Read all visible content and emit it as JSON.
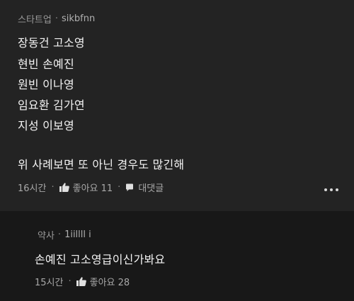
{
  "comment": {
    "author": "스타트업",
    "author_id": "sikbfnn",
    "lines": [
      "장동건 고소영",
      "현빈 손예진",
      "원빈 이나영",
      "임요환 김가연",
      "지성 이보영",
      "위 사례보면 또 아닌 경우도 많긴해"
    ],
    "time": "16시간",
    "likes_label": "좋아요 11",
    "reply_label": "대댓글"
  },
  "reply": {
    "author": "약사",
    "author_id": "1iillll i",
    "text": "손예진 고소영급이신가봐요",
    "time": "15시간",
    "likes_label": "좋아요 28"
  },
  "icons": {
    "like": "thumbs-up-icon",
    "reply": "speech-bubble-icon",
    "more": "more-options-icon"
  }
}
